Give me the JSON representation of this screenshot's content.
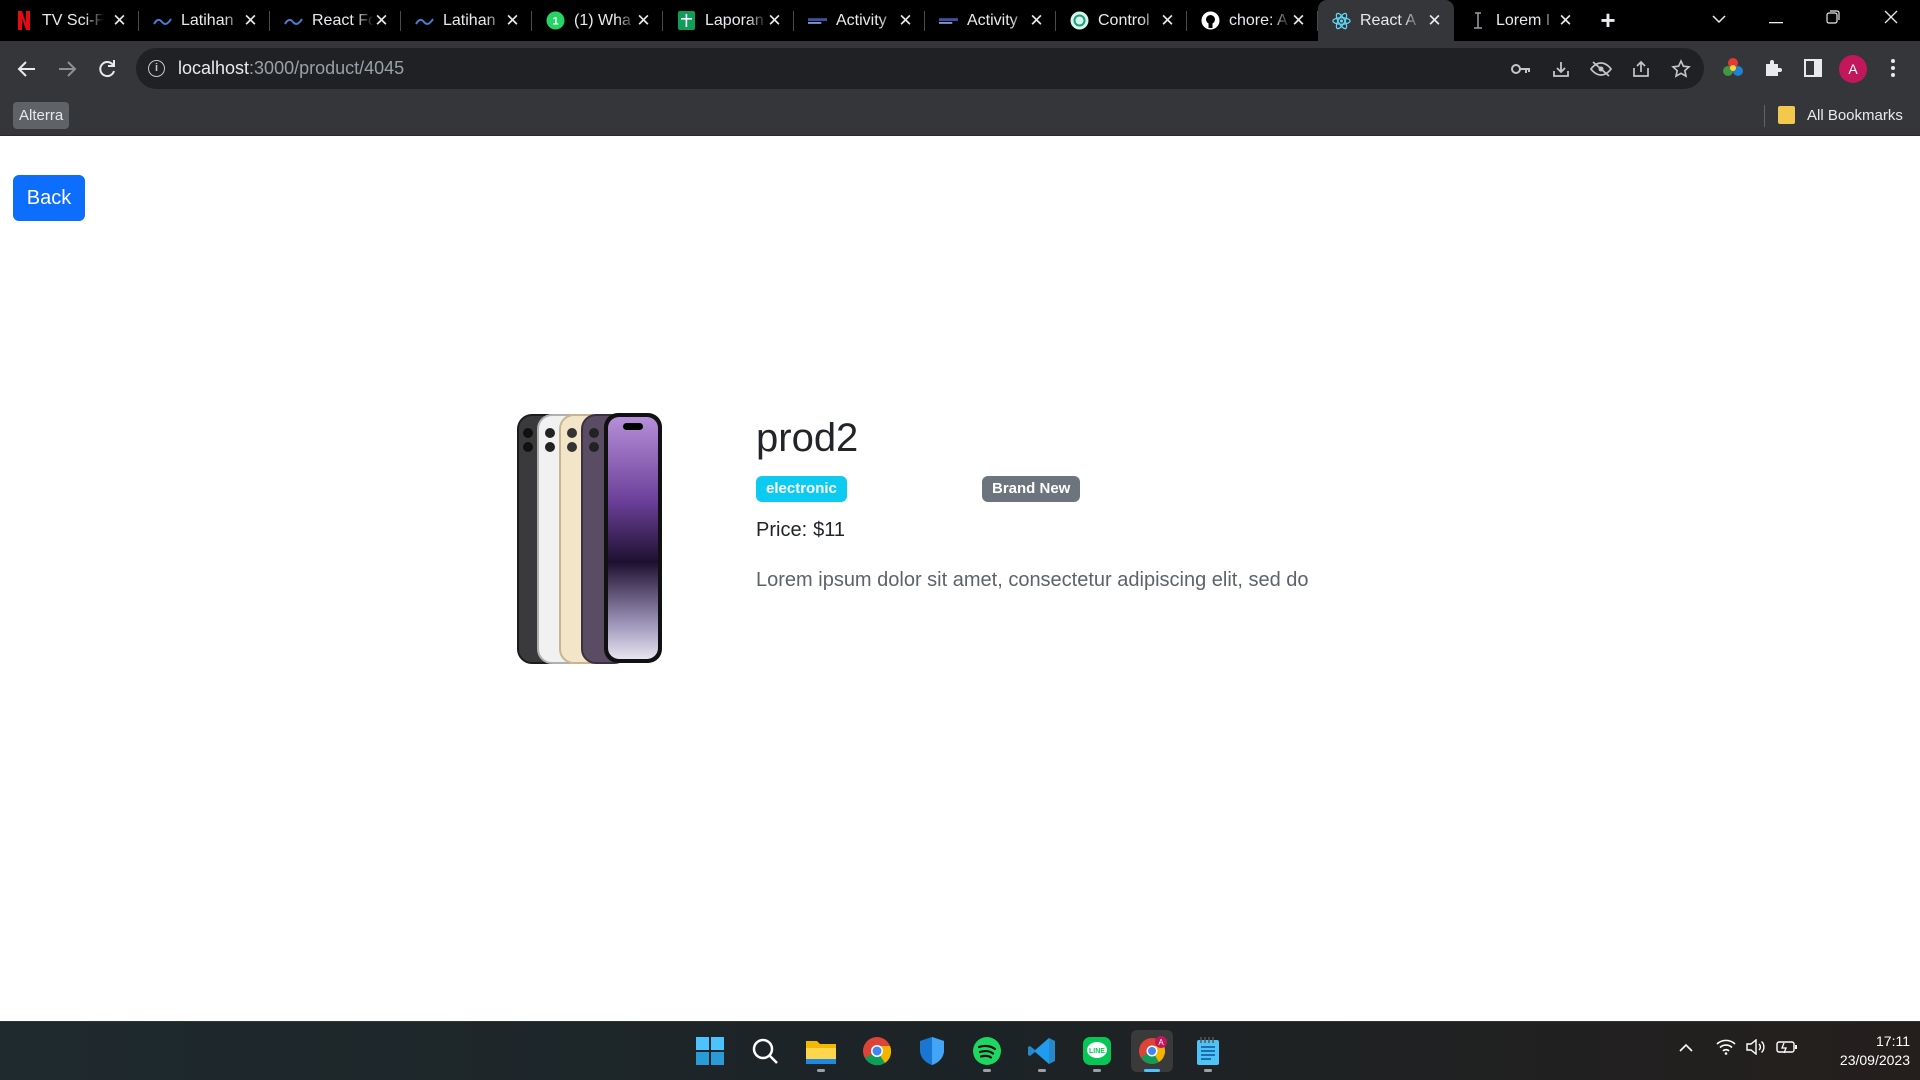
{
  "browser": {
    "tabs": [
      {
        "title": "TV Sci-Fi",
        "icon": "netflix-icon"
      },
      {
        "title": "Latihan",
        "icon": "alterra-icon"
      },
      {
        "title": "React Fo",
        "icon": "alterra-icon"
      },
      {
        "title": "Latihan",
        "icon": "alterra-icon"
      },
      {
        "title": "(1) Wha",
        "icon": "whatsapp-icon"
      },
      {
        "title": "Laporan",
        "icon": "sheets-icon"
      },
      {
        "title": "Activity",
        "icon": "activity-icon"
      },
      {
        "title": "Activity",
        "icon": "activity-icon"
      },
      {
        "title": "Control",
        "icon": "chatgpt-icon"
      },
      {
        "title": "chore: A",
        "icon": "github-icon"
      },
      {
        "title": "React A",
        "icon": "react-icon",
        "active": true
      },
      {
        "title": "Lorem I",
        "icon": "lorem-icon"
      }
    ],
    "url_host": "localhost",
    "url_path": ":3000/product/4045",
    "bookmarks": {
      "chip": "Alterra",
      "all_bookmarks": "All Bookmarks"
    },
    "avatar_letter": "A"
  },
  "page": {
    "back_label": "Back",
    "product": {
      "name": "prod2",
      "category": "electronic",
      "condition": "Brand New",
      "price_label": "Price:",
      "price": "$11",
      "description": "Lorem ipsum dolor sit amet, consectetur adipiscing elit, sed do"
    }
  },
  "taskbar": {
    "time": "17:11",
    "date": "23/09/2023",
    "apps": [
      "start-icon",
      "search-icon",
      "file-explorer-icon",
      "chrome-icon",
      "defender-icon",
      "spotify-icon",
      "vscode-icon",
      "line-icon",
      "chrome-profile-icon",
      "notepad-icon"
    ]
  },
  "colors": {
    "primary": "#0d6efd",
    "info": "#0dcaf0",
    "secondary": "#6c757d",
    "chrome_dark": "#35363a"
  }
}
